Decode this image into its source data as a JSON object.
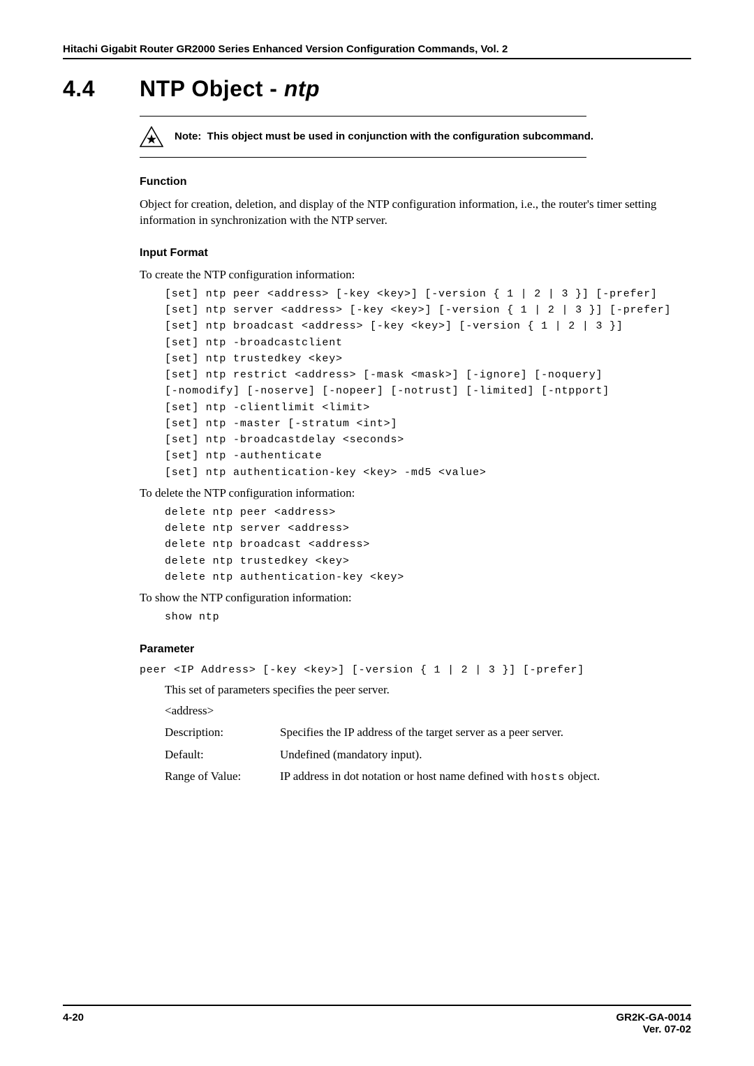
{
  "running_head": "Hitachi Gigabit Router GR2000 Series Enhanced Version Configuration Commands, Vol. 2",
  "section": {
    "number": "4.4",
    "title_plain": "NTP Object - ",
    "title_ital": "ntp"
  },
  "note": {
    "label": "Note:",
    "text": "This object must be used in conjunction with the configuration subcommand."
  },
  "function": {
    "heading": "Function",
    "text": "Object for creation, deletion, and display of the NTP configuration information, i.e., the router's timer setting information in synchronization with the NTP server."
  },
  "input_format": {
    "heading": "Input Format",
    "create_intro": "To create the NTP configuration information:",
    "create_code": "[set] ntp peer <address> [-key <key>] [-version { 1 | 2 | 3 }] [-prefer]\n[set] ntp server <address> [-key <key>] [-version { 1 | 2 | 3 }] [-prefer]\n[set] ntp broadcast <address> [-key <key>] [-version { 1 | 2 | 3 }]\n[set] ntp -broadcastclient\n[set] ntp trustedkey <key>\n[set] ntp restrict <address> [-mask <mask>] [-ignore] [-noquery]\n[-nomodify] [-noserve] [-nopeer] [-notrust] [-limited] [-ntpport]\n[set] ntp -clientlimit <limit>\n[set] ntp -master [-stratum <int>]\n[set] ntp -broadcastdelay <seconds>\n[set] ntp -authenticate\n[set] ntp authentication-key <key> -md5 <value>",
    "delete_intro": "To delete the NTP configuration information:",
    "delete_code": "delete ntp peer <address>\ndelete ntp server <address>\ndelete ntp broadcast <address>\ndelete ntp trustedkey <key>\ndelete ntp authentication-key <key>",
    "show_intro": "To show the NTP configuration information:",
    "show_code": "show ntp"
  },
  "parameter": {
    "heading": "Parameter",
    "line": "peer <IP Address> [-key <key>] [-version { 1 | 2 | 3 }] [-prefer]",
    "desc": "This set of parameters specifies the peer server.",
    "address_label": "<address>",
    "rows": [
      {
        "key": "Description:",
        "val_pre": "Specifies the IP address of the target server as a peer server.",
        "mono": "",
        "val_post": ""
      },
      {
        "key": "Default:",
        "val_pre": "Undefined (mandatory input).",
        "mono": "",
        "val_post": ""
      },
      {
        "key": "Range of Value:",
        "val_pre": "IP address in dot notation or host name defined with ",
        "mono": "hosts",
        "val_post": " object."
      }
    ]
  },
  "footer": {
    "left": "4-20",
    "right1": "GR2K-GA-0014",
    "right2": "Ver. 07-02"
  }
}
